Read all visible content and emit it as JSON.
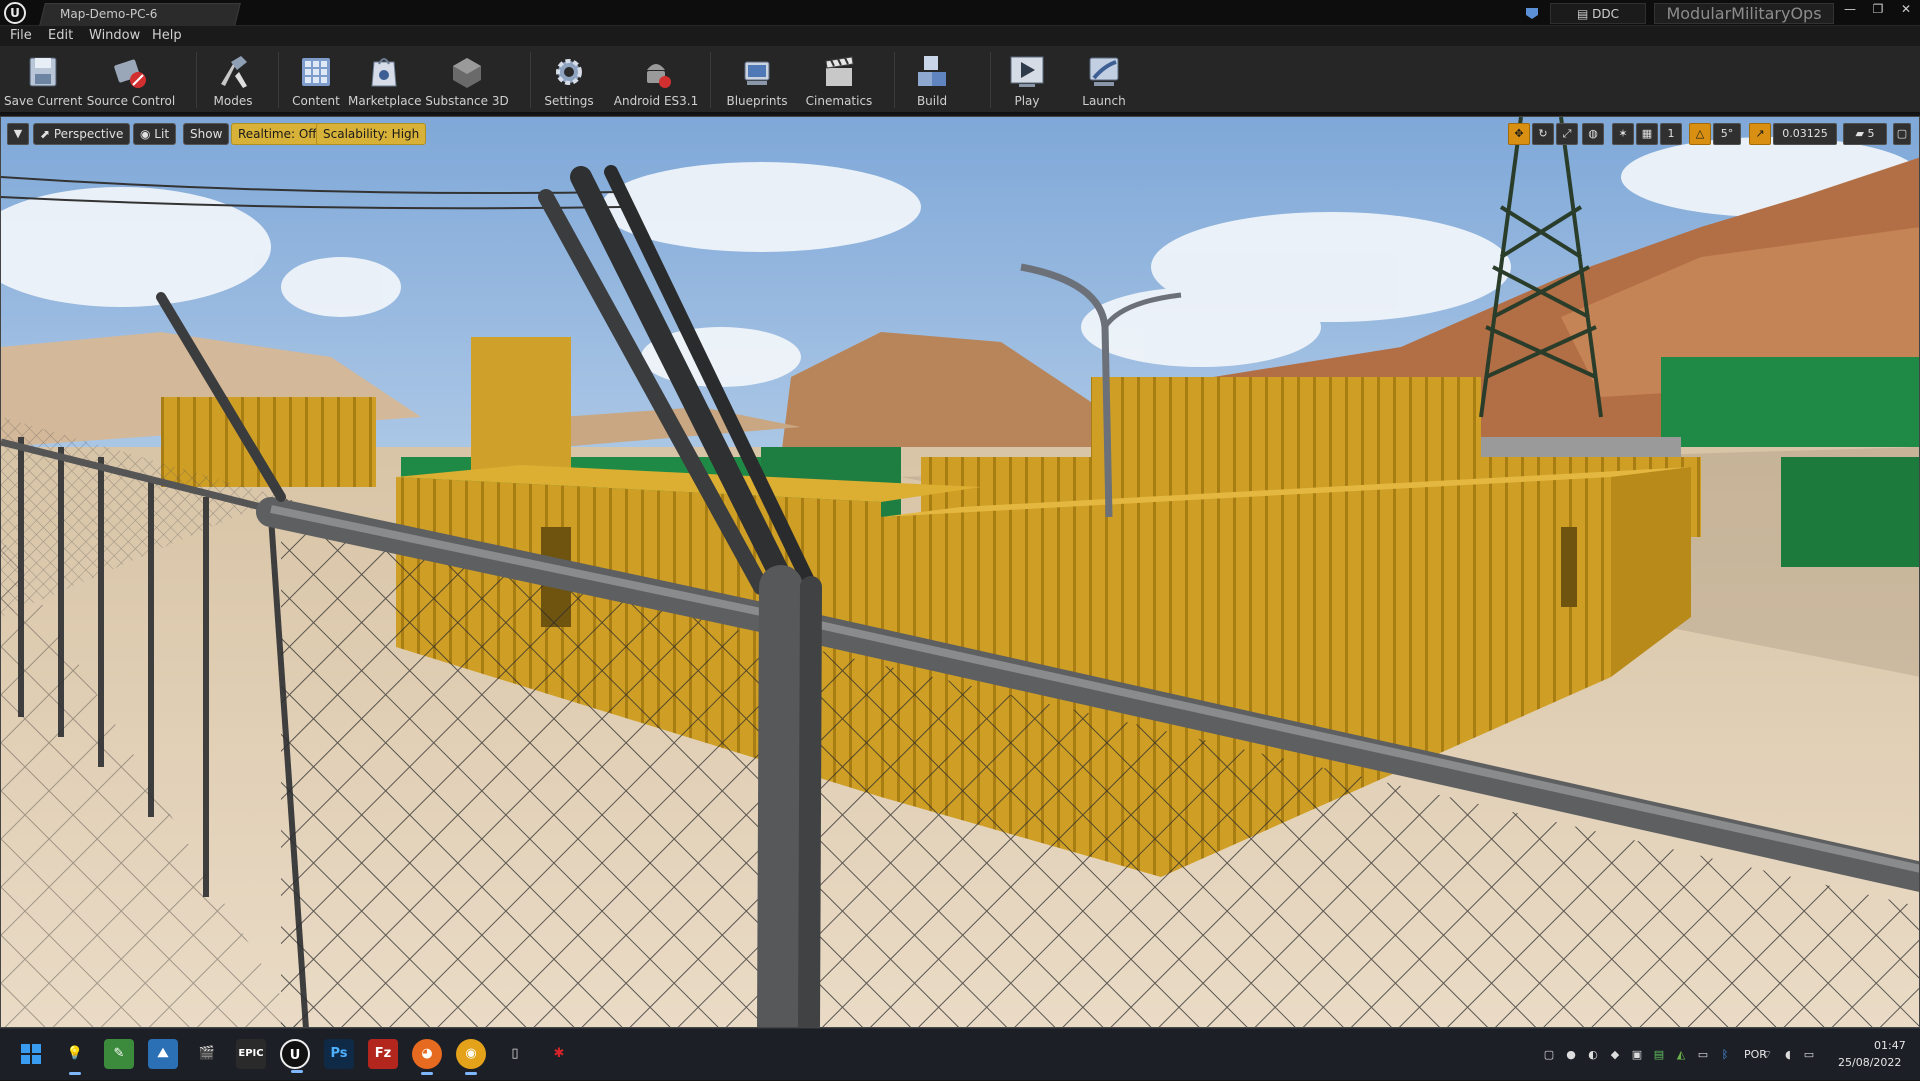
{
  "window": {
    "tab_title": "Map-Demo-PC-6",
    "ddc_label": "DDC",
    "project_name": "ModularMilitaryOps",
    "min_glyph": "—",
    "max_glyph": "❐",
    "close_glyph": "✕"
  },
  "menu": [
    "File",
    "Edit",
    "Window",
    "Help"
  ],
  "toolbar": {
    "save": "Save Current",
    "source_control": "Source Control",
    "modes": "Modes",
    "content": "Content",
    "marketplace": "Marketplace",
    "substance": "Substance 3D",
    "settings": "Settings",
    "android": "Android ES3.1",
    "blueprints": "Blueprints",
    "cinematics": "Cinematics",
    "build": "Build",
    "play": "Play",
    "launch": "Launch"
  },
  "viewport": {
    "perspective": "Perspective",
    "lit": "Lit",
    "show": "Show",
    "realtime": "Realtime: Off",
    "scalability": "Scalability: High",
    "grid_value": "1",
    "rotation_snap": "5°",
    "scale_snap": "0.03125",
    "camera_speed": "5"
  },
  "taskbar": {
    "apps": [
      "start",
      "explorer-bulb",
      "notepad",
      "photos",
      "clapper",
      "epic-games",
      "unreal",
      "photoshop",
      "filezilla",
      "firefox",
      "chrome",
      "tablet",
      "spider"
    ],
    "language": "POR",
    "time": "01:47",
    "date": "25/08/2022"
  },
  "colors": {
    "container_yellow": "#d6a928",
    "container_green": "#1f8a45",
    "sky": "#a9c6e6",
    "sand": "#e2cfb6"
  }
}
